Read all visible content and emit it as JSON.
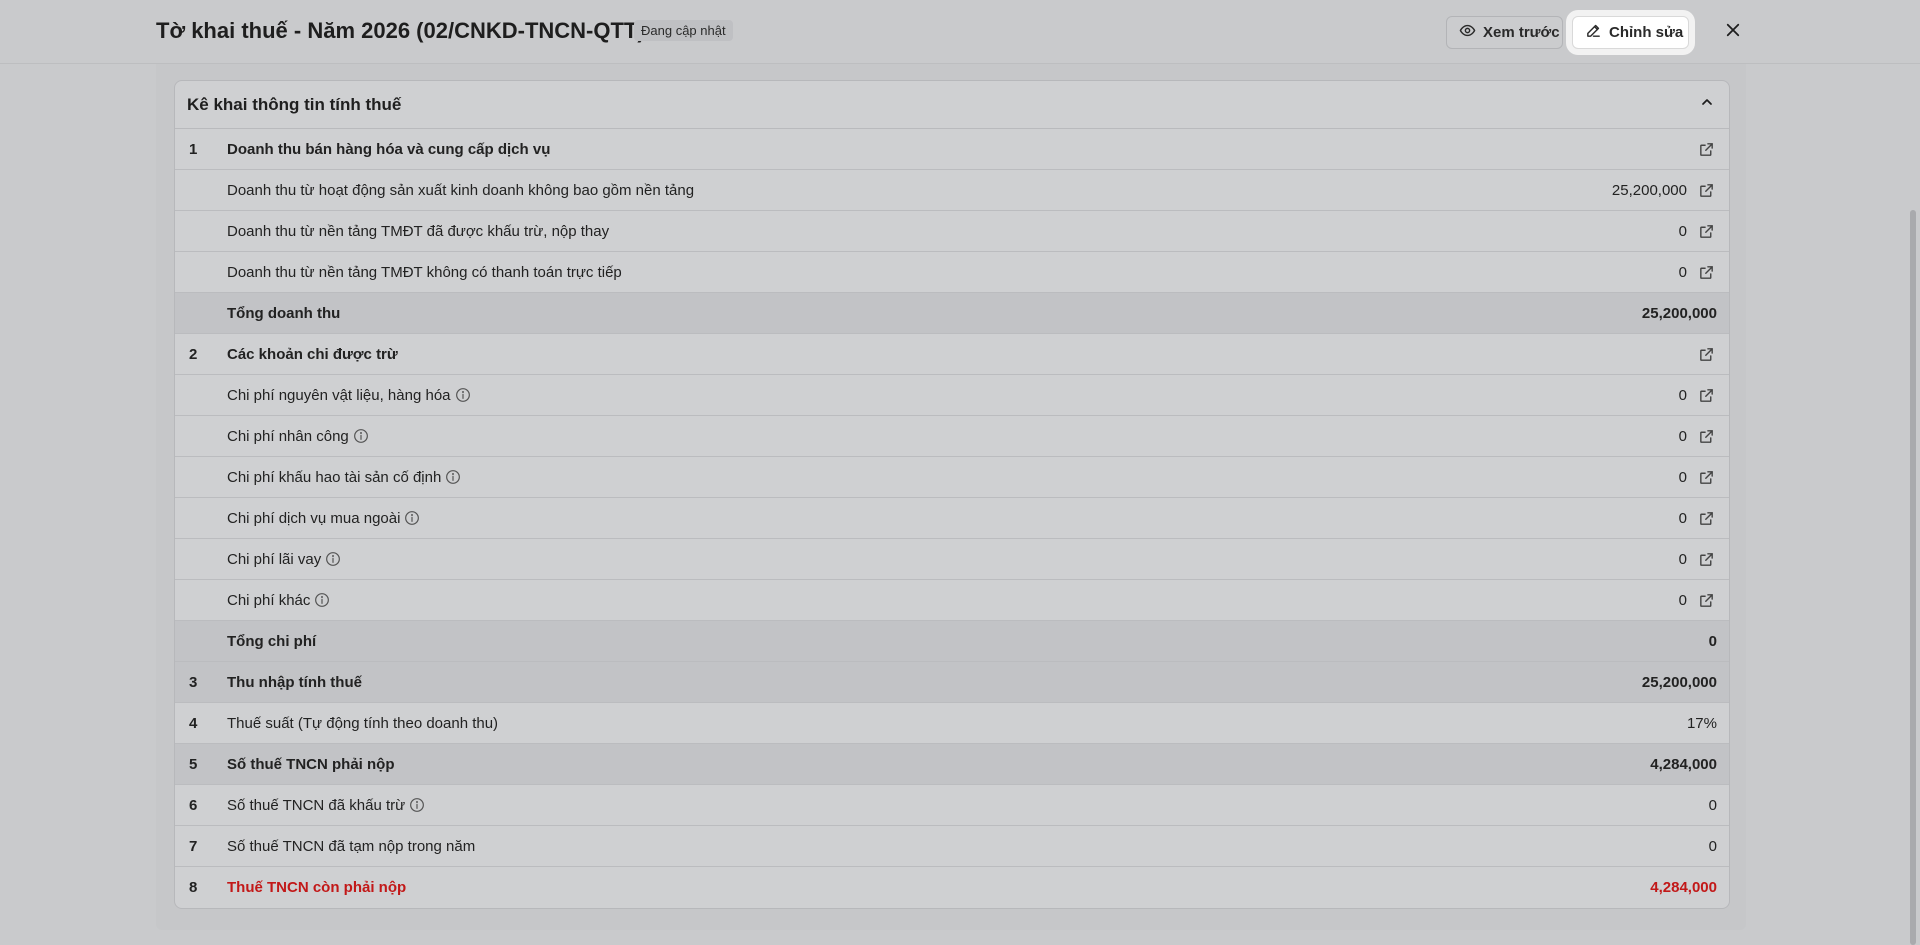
{
  "header": {
    "title": "Tờ khai thuế - Năm 2026 (02/CNKD-TNCN-QTT)",
    "status_badge": "Đang cập nhật",
    "preview_label": "Xem trước",
    "edit_label": "Chỉnh sửa"
  },
  "section": {
    "title": "Kê khai thông tin tính thuế",
    "rows": [
      {
        "num": "1",
        "label": "Doanh thu bán hàng hóa và cung cấp dịch vụ",
        "value": "",
        "bold": true,
        "link": true,
        "info": false
      },
      {
        "num": "",
        "label": "Doanh thu từ hoạt động sản xuất kinh doanh không bao gồm nền tảng",
        "value": "25,200,000",
        "link": true,
        "info": false
      },
      {
        "num": "",
        "label": "Doanh thu từ nền tảng TMĐT đã được khấu trừ, nộp thay",
        "value": "0",
        "link": true,
        "info": false
      },
      {
        "num": "",
        "label": "Doanh thu từ nền tảng TMĐT không có thanh toán trực tiếp",
        "value": "0",
        "link": true,
        "info": false
      },
      {
        "num": "",
        "label": "Tổng doanh thu",
        "value": "25,200,000",
        "bold": true,
        "shaded": true,
        "link": false,
        "info": false
      },
      {
        "num": "2",
        "label": "Các khoản chi được trừ",
        "value": "",
        "bold": true,
        "link": true,
        "info": false
      },
      {
        "num": "",
        "label": "Chi phí nguyên vật liệu, hàng hóa",
        "value": "0",
        "link": true,
        "info": true
      },
      {
        "num": "",
        "label": "Chi phí nhân công",
        "value": "0",
        "link": true,
        "info": true
      },
      {
        "num": "",
        "label": "Chi phí khấu hao tài sản cố định",
        "value": "0",
        "link": true,
        "info": true
      },
      {
        "num": "",
        "label": "Chi phí dịch vụ mua ngoài",
        "value": "0",
        "link": true,
        "info": true
      },
      {
        "num": "",
        "label": "Chi phí lãi vay",
        "value": "0",
        "link": true,
        "info": true
      },
      {
        "num": "",
        "label": "Chi phí khác",
        "value": "0",
        "link": true,
        "info": true
      },
      {
        "num": "",
        "label": "Tổng chi phí",
        "value": "0",
        "bold": true,
        "shaded": true,
        "link": false,
        "info": false
      },
      {
        "num": "3",
        "label": "Thu nhập tính thuế",
        "value": "25,200,000",
        "bold": true,
        "shaded": true,
        "link": false,
        "info": false
      },
      {
        "num": "4",
        "label": "Thuế suất (Tự động tính theo doanh thu)",
        "value": "17%",
        "link": false,
        "info": false
      },
      {
        "num": "5",
        "label": "Số thuế TNCN phải nộp",
        "value": "4,284,000",
        "bold": true,
        "shaded": true,
        "link": false,
        "info": false
      },
      {
        "num": "6",
        "label": "Số thuế TNCN đã khấu trừ",
        "value": "0",
        "link": false,
        "info": true
      },
      {
        "num": "7",
        "label": "Số thuế TNCN đã tạm nộp trong năm",
        "value": "0",
        "link": false,
        "info": false
      },
      {
        "num": "8",
        "label": "Thuế TNCN còn phải nộp",
        "value": "4,284,000",
        "red": true,
        "link": false,
        "info": false
      }
    ]
  },
  "colors": {
    "accent_red": "#c21818",
    "overlay": "#c9cacc"
  },
  "icons": {
    "preview": "eye-icon",
    "edit": "pencil-icon",
    "close": "close-icon",
    "collapse": "chevron-up-icon",
    "row_link": "external-link-icon",
    "info": "info-icon"
  }
}
